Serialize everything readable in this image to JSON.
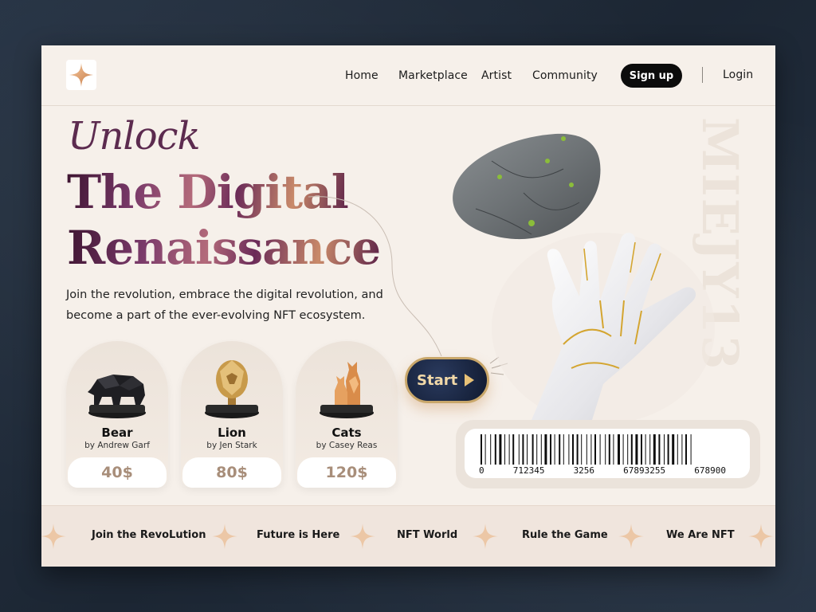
{
  "nav": {
    "links": [
      "Home",
      "Marketplace",
      "Artist",
      "Community"
    ],
    "signup_label": "Sign up",
    "login_label": "Login"
  },
  "hero": {
    "kicker": "Unlock",
    "title_line1": "The Digital",
    "title_line2": "Renaissance",
    "description": "Join the revolution, embrace the digital revolution, and become a part of the ever-evolving NFT ecosystem.",
    "start_label": "Start",
    "vertical_text": "MIEJY13"
  },
  "cards": [
    {
      "name": "Bear",
      "artist": "by Andrew Garf",
      "price": "40$",
      "figure": "bear-sculpture"
    },
    {
      "name": "Lion",
      "artist": "by Jen Stark",
      "price": "80$",
      "figure": "lion-sculpture"
    },
    {
      "name": "Cats",
      "artist": "by Casey Reas",
      "price": "120$",
      "figure": "cats-sculpture"
    }
  ],
  "barcode": {
    "digits": [
      "0",
      "712345",
      "3256",
      "67893255",
      "678900"
    ]
  },
  "ticker": [
    "Join the RevoLution",
    "Future is Here",
    "NFT World",
    "Rule the Game",
    "We Are NFT"
  ],
  "colors": {
    "page_bg": "#f6f0ea",
    "accent_purple": "#5c2b4f",
    "price_tan": "#a88e7a",
    "start_gold": "#c9a76a"
  }
}
